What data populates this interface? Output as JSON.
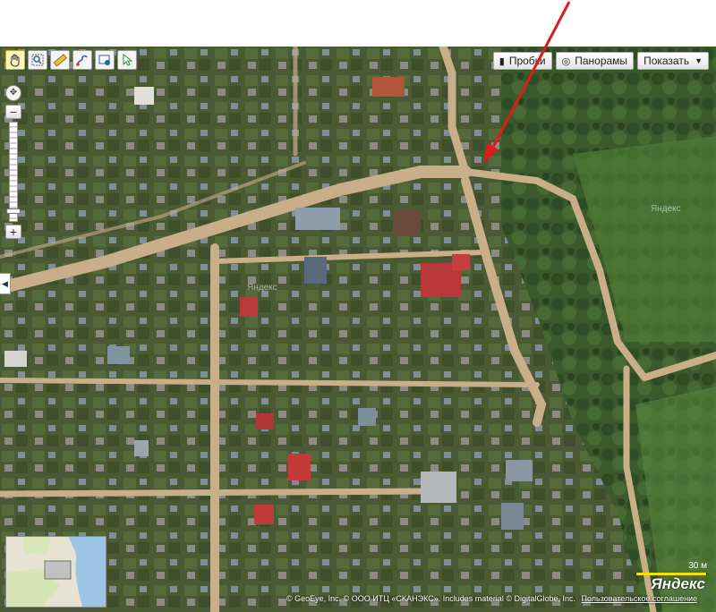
{
  "controls": {
    "traffic_label": "Пробки",
    "panoramas_label": "Панорамы",
    "show_label": "Показать",
    "zoom_in": "+",
    "zoom_out": "−",
    "zoom_level_fraction": 0.92
  },
  "icons": {
    "toolbar": [
      "hand-drag-icon",
      "magnifier-zoom-icon",
      "ruler-icon",
      "route-icon",
      "map-object-icon",
      "pointer-icon"
    ],
    "traffic": "traffic-light-icon",
    "panoramas": "panorama-icon",
    "show_dropdown": "chevron-down-icon",
    "nav": "compass-icon",
    "side_collapse": "chevron-left-icon"
  },
  "map": {
    "watermark_1": "Яндекс",
    "watermark_2": "Яндекс",
    "scale_label": "30 м",
    "brand": "Яндекс",
    "copyright": "© GeoEye, Inc. © ООО ИТЦ «СКАНЭКС». Includes material © DigitalGlobe, Inc.",
    "terms_link": "Пользовательское соглашение"
  },
  "colors": {
    "annotation_arrow": "#e01b1b",
    "scale_bar": "#f2e200",
    "road": "#c9ae8a",
    "vegetation": "#3b5a2a"
  }
}
